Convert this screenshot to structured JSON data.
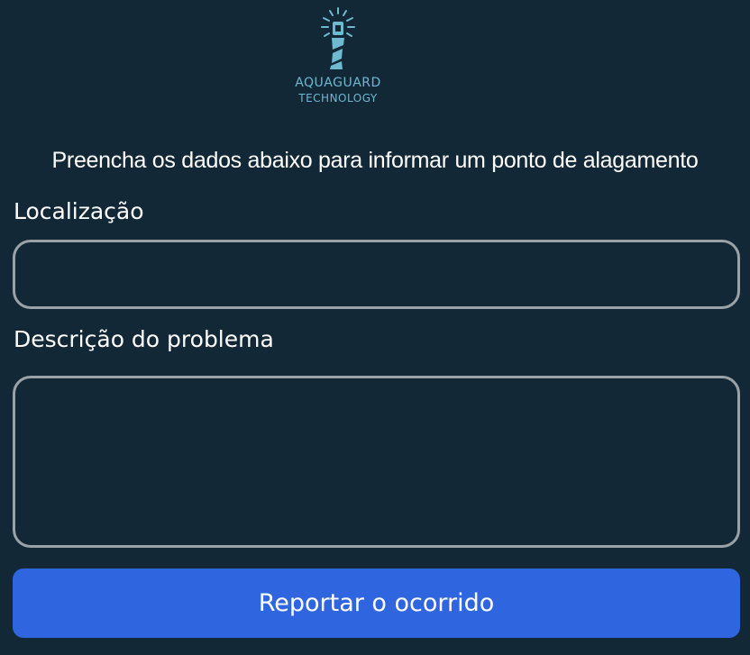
{
  "brand": {
    "name": "AQUAGUARD",
    "subtitle": "TECHNOLOGY",
    "logo_icon": "lighthouse-icon",
    "accent_color": "#6eb8d0"
  },
  "form": {
    "intro": "Preencha os dados abaixo para informar um ponto de alagamento",
    "location_label": "Localização",
    "location_value": "",
    "description_label": "Descrição do problema",
    "description_value": "",
    "submit_label": "Reportar o ocorrido"
  },
  "colors": {
    "background": "#132837",
    "field_border": "#9aa1a7",
    "button": "#2f66df"
  }
}
